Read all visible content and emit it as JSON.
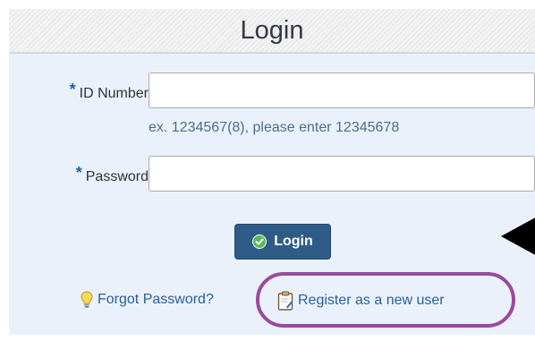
{
  "header": {
    "title": "Login"
  },
  "form": {
    "required_mark": "*",
    "id_number": {
      "label": "ID Number",
      "value": "",
      "placeholder": "",
      "hint": "ex. 1234567(8), please enter 12345678"
    },
    "password": {
      "label": "Password",
      "value": "",
      "placeholder": ""
    },
    "login_button": {
      "label": "Login",
      "icon": "check-circle-icon",
      "color": "#2e5c87"
    }
  },
  "links": {
    "forgot_password": {
      "label": "Forgot Password?",
      "icon": "lightbulb-icon"
    },
    "register": {
      "label": "Register as a new user",
      "icon": "clipboard-icon"
    }
  },
  "annotations": {
    "highlight_color": "#9a4a9c",
    "arrow_color": "#000000"
  }
}
